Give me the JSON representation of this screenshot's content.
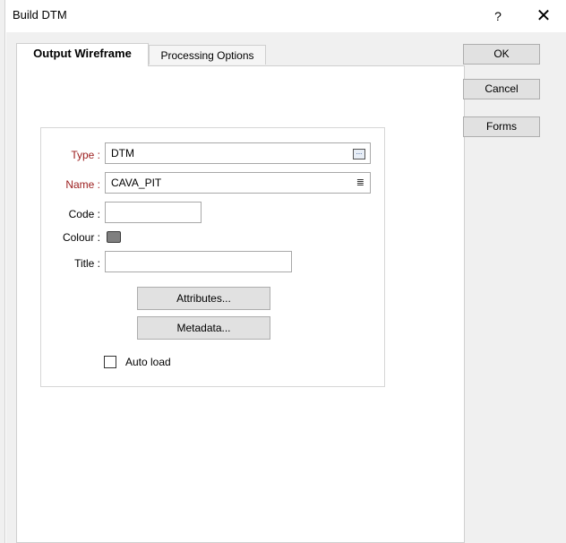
{
  "window": {
    "title": "Build DTM",
    "help_label": "?",
    "close_label": "✕"
  },
  "tabs": [
    {
      "label": "Output Wireframe",
      "active": true
    },
    {
      "label": "Processing Options",
      "active": false
    }
  ],
  "form": {
    "type_label": "Type :",
    "type_value": "DTM",
    "name_label": "Name :",
    "name_value": "CAVA_PIT",
    "code_label": "Code :",
    "code_value": "",
    "colour_label": "Colour :",
    "colour_value": "#7f7f7f",
    "title_label": "Title :",
    "title_value": "",
    "attributes_button": "Attributes...",
    "metadata_button": "Metadata...",
    "autoload_label": "Auto load",
    "autoload_checked": false
  },
  "side_buttons": {
    "ok": "OK",
    "cancel": "Cancel",
    "forms": "Forms"
  },
  "icons": {
    "type_browse": "browse-icon",
    "name_list": "list-icon",
    "close": "close-icon",
    "help": "help-icon"
  }
}
